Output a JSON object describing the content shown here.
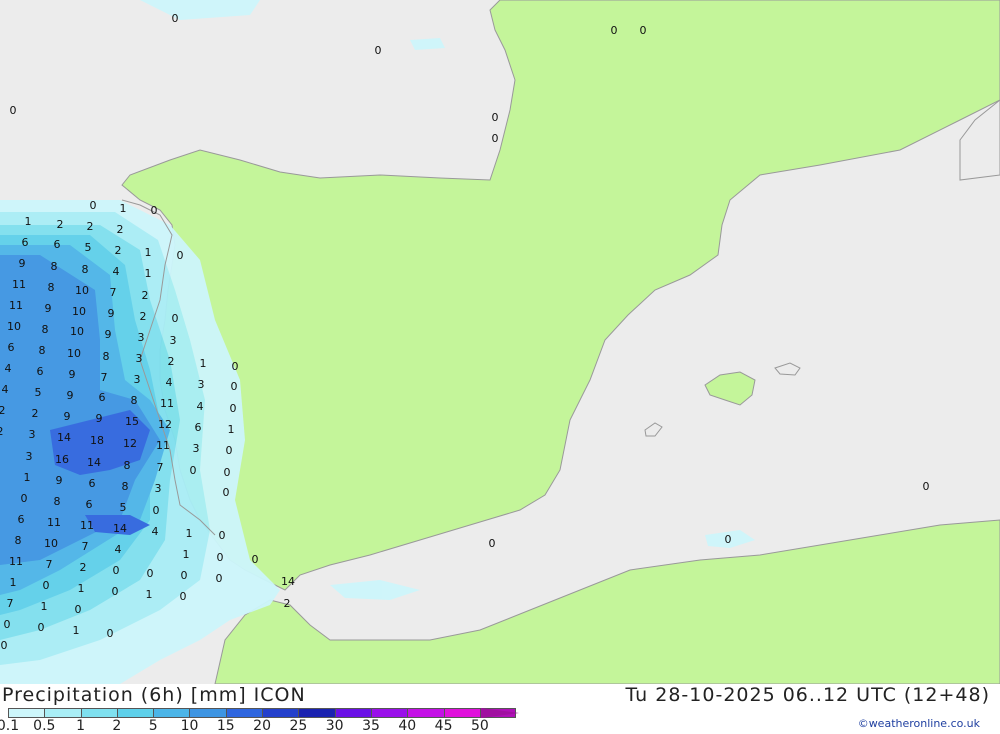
{
  "title": "Precipitation (6h) [mm] ICON",
  "valid_time": "Tu 28-10-2025 06..12 UTC (12+48)",
  "credit": "©weatheronline.co.uk",
  "colors": {
    "sea": "#ececec",
    "land": "#c4f59a",
    "coast": "#999999"
  },
  "legend": [
    {
      "label": "0.1",
      "color": "#cdf6fb"
    },
    {
      "label": "0.5",
      "color": "#a9eef6"
    },
    {
      "label": "1",
      "color": "#7fe0ef"
    },
    {
      "label": "2",
      "color": "#5ed0ea"
    },
    {
      "label": "5",
      "color": "#4cb5e8"
    },
    {
      "label": "10",
      "color": "#3e95e3"
    },
    {
      "label": "15",
      "color": "#2f66df"
    },
    {
      "label": "20",
      "color": "#2440cc"
    },
    {
      "label": "25",
      "color": "#1a22b0"
    },
    {
      "label": "30",
      "color": "#6a10e6"
    },
    {
      "label": "35",
      "color": "#9a10ea"
    },
    {
      "label": "40",
      "color": "#c410e6"
    },
    {
      "label": "45",
      "color": "#e010dc"
    },
    {
      "label": "50",
      "color": "#b010b8"
    }
  ],
  "map_values": [
    "0",
    "0",
    "0",
    "0",
    "0",
    "0",
    "0",
    "1",
    "0",
    "1",
    "2",
    "2",
    "2",
    "0",
    "6",
    "6",
    "5",
    "2",
    "1",
    "0",
    "9",
    "8",
    "8",
    "4",
    "1",
    "11",
    "8",
    "10",
    "7",
    "2",
    "11",
    "9",
    "10",
    "9",
    "2",
    "0",
    "10",
    "8",
    "10",
    "9",
    "3",
    "3",
    "6",
    "8",
    "10",
    "8",
    "3",
    "2",
    "1",
    "0",
    "4",
    "6",
    "9",
    "7",
    "3",
    "4",
    "3",
    "0",
    "4",
    "5",
    "9",
    "6",
    "8",
    "11",
    "4",
    "0",
    "2",
    "2",
    "9",
    "9",
    "15",
    "12",
    "6",
    "1",
    "2",
    "3",
    "14",
    "18",
    "12",
    "11",
    "3",
    "0",
    "3",
    "16",
    "14",
    "8",
    "7",
    "0",
    "0",
    "1",
    "9",
    "6",
    "8",
    "3",
    "0",
    "0",
    "8",
    "6",
    "5",
    "0",
    "6",
    "11",
    "11",
    "14",
    "4",
    "1",
    "0",
    "8",
    "10",
    "7",
    "4",
    "1",
    "0",
    "0",
    "11",
    "7",
    "2",
    "0",
    "0",
    "0",
    "0",
    "14",
    "1",
    "0",
    "1",
    "0",
    "1",
    "0",
    "7",
    "1",
    "0",
    "2",
    "0",
    "0",
    "1",
    "0",
    "0",
    "0",
    "0",
    "0",
    "0",
    "0"
  ]
}
